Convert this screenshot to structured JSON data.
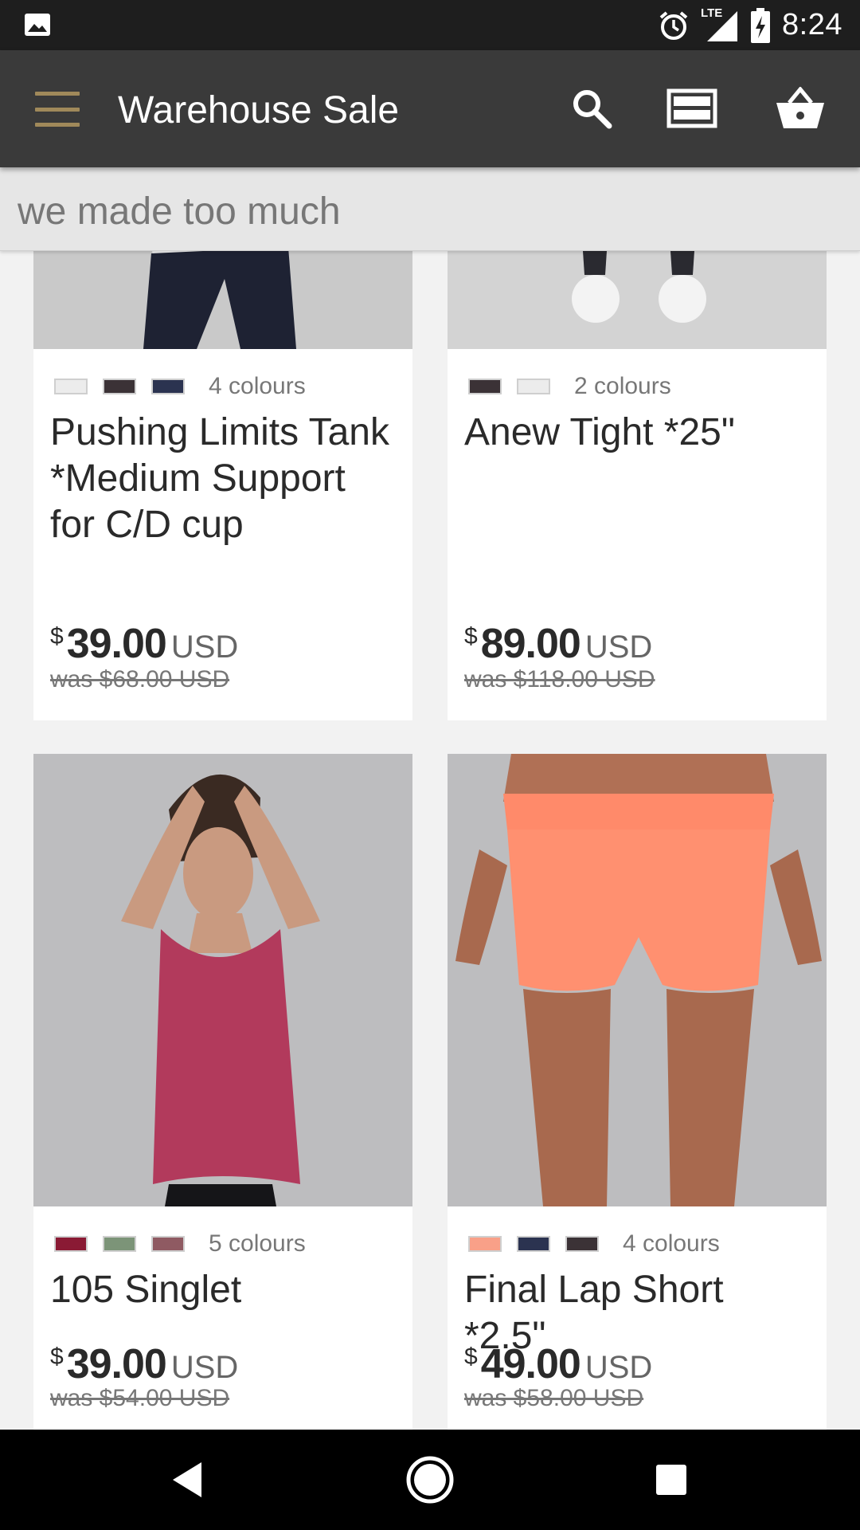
{
  "status_bar": {
    "network": "LTE",
    "time": "8:24"
  },
  "app_bar": {
    "title": "Warehouse Sale",
    "icons": [
      "menu-icon",
      "search-icon",
      "view-toggle-icon",
      "basket-icon"
    ]
  },
  "tagline": "we made too much",
  "products": [
    {
      "name": "Pushing Limits Tank *Medium Support for C/D cup",
      "colours_label": "4 colours",
      "swatches": [
        "#ececec",
        "#3b3236",
        "#2b3350"
      ],
      "currency_symbol": "$",
      "price": "39.00",
      "currency_code": "USD",
      "was": "was $68.00 USD"
    },
    {
      "name": "Anew Tight *25\"",
      "colours_label": "2 colours",
      "swatches": [
        "#3b3236",
        "#ececec"
      ],
      "currency_symbol": "$",
      "price": "89.00",
      "currency_code": "USD",
      "was": "was $118.00 USD"
    },
    {
      "name": "105 Singlet",
      "colours_label": "5 colours",
      "swatches": [
        "#8a1a34",
        "#7c9478",
        "#8f5a62"
      ],
      "currency_symbol": "$",
      "price": "39.00",
      "currency_code": "USD",
      "was": "was $54.00 USD"
    },
    {
      "name": "Final Lap Short *2.5\"",
      "colours_label": "4 colours",
      "swatches": [
        "#f9a088",
        "#2b3350",
        "#3b3236"
      ],
      "currency_symbol": "$",
      "price": "49.00",
      "currency_code": "USD",
      "was": "was $58.00 USD"
    }
  ],
  "nav_bar": {
    "icons": [
      "back-icon",
      "home-icon",
      "recents-icon"
    ]
  }
}
